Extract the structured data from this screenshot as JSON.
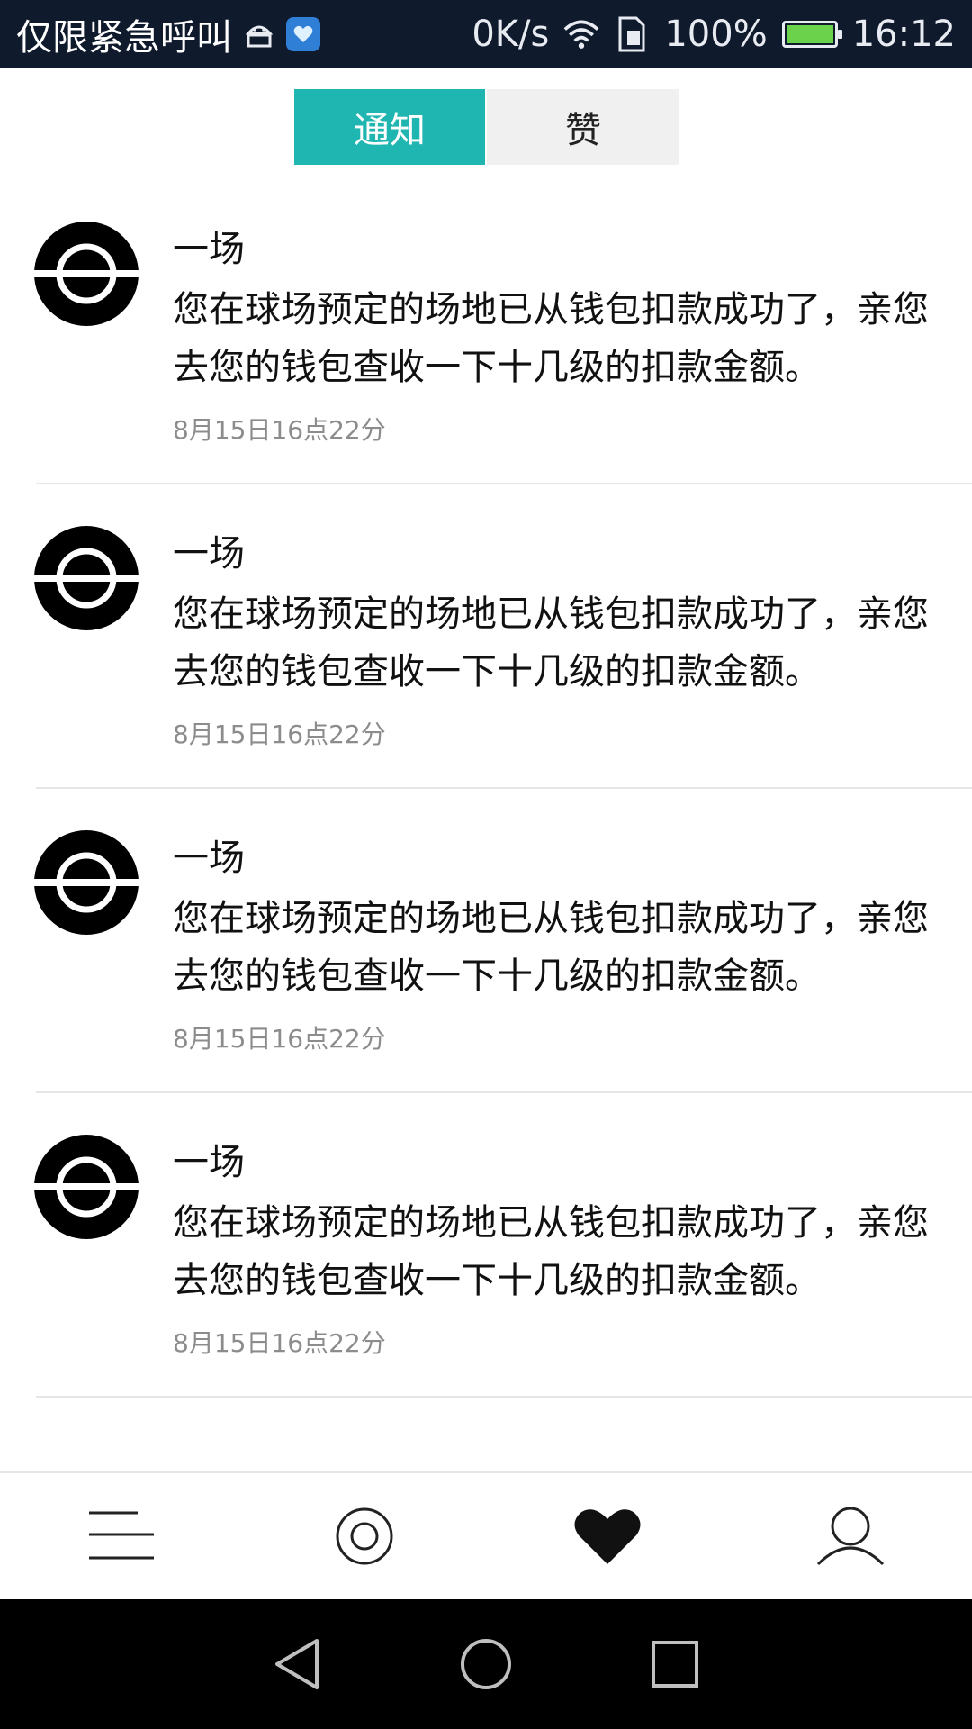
{
  "status_bar": {
    "carrier": "仅限紧急呼叫",
    "speed": "0K/s",
    "battery": "100%",
    "time": "16:12",
    "icons": [
      "android-icon",
      "app-badge-icon",
      "wifi-icon",
      "sim-icon",
      "battery-icon"
    ]
  },
  "tabs": [
    {
      "label": "通知",
      "active": true
    },
    {
      "label": "赞",
      "active": false
    }
  ],
  "notifications": [
    {
      "title": "一场",
      "body": "您在球场预定的场地已从钱包扣款成功了，亲您去您的钱包查收一下十几级的扣款金额。",
      "time": "8月15日16点22分"
    },
    {
      "title": "一场",
      "body": "您在球场预定的场地已从钱包扣款成功了，亲您去您的钱包查收一下十几级的扣款金额。",
      "time": "8月15日16点22分"
    },
    {
      "title": "一场",
      "body": "您在球场预定的场地已从钱包扣款成功了，亲您去您的钱包查收一下十几级的扣款金额。",
      "time": "8月15日16点22分"
    },
    {
      "title": "一场",
      "body": "您在球场预定的场地已从钱包扣款成功了，亲您去您的钱包查收一下十几级的扣款金额。",
      "time": "8月15日16点22分"
    }
  ],
  "bottom_nav": [
    "menu-icon",
    "target-icon",
    "heart-icon",
    "user-icon"
  ],
  "colors": {
    "accent": "#1fb5b0",
    "status_bar_bg": "#0f1a2c",
    "time_text": "#8c8c8c"
  }
}
